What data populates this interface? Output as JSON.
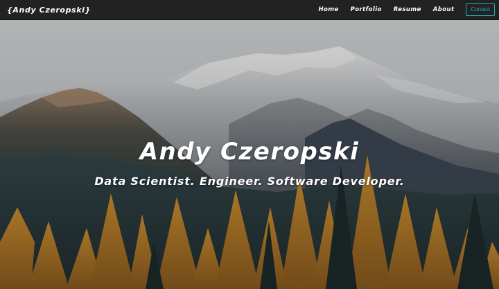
{
  "navbar": {
    "brand": "{Andy Czeropski}",
    "links": [
      {
        "label": "Home"
      },
      {
        "label": "Portfolio"
      },
      {
        "label": "Resume"
      },
      {
        "label": "About"
      }
    ],
    "contact_label": "Contact"
  },
  "hero": {
    "title": "Andy Czeropski",
    "subtitle": "Data Scientist. Engineer. Software Developer."
  },
  "colors": {
    "navbar_bg": "#222222",
    "accent": "#2aa8b8",
    "text": "#ffffff"
  }
}
